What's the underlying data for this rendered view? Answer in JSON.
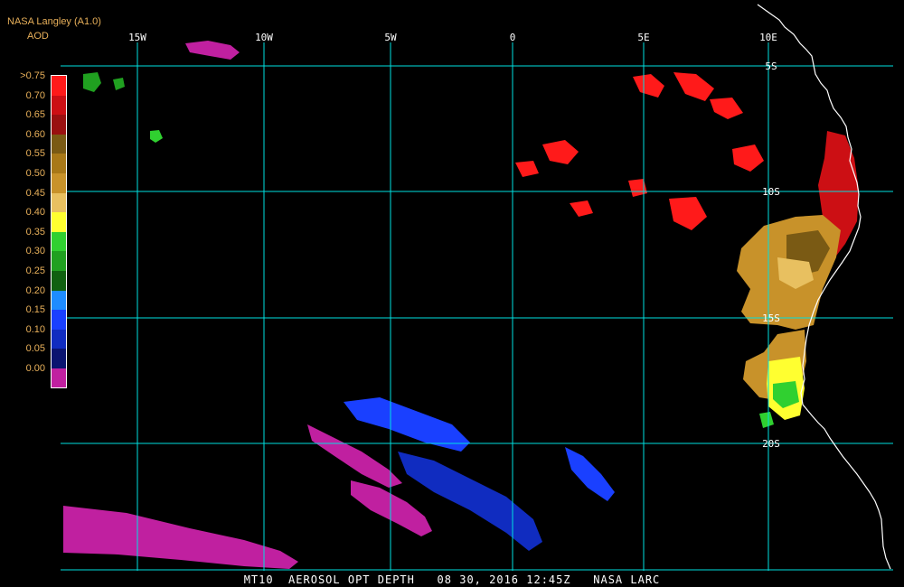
{
  "header": {
    "producer": "NASA Langley (A1.0)",
    "variable": "AOD"
  },
  "colorbar": {
    "labels": [
      ">0.75",
      "0.70",
      "0.65",
      "0.60",
      "0.55",
      "0.50",
      "0.45",
      "0.40",
      "0.35",
      "0.30",
      "0.25",
      "0.20",
      "0.15",
      "0.10",
      "0.05",
      "0.00"
    ],
    "colors": [
      "#ff1a1a",
      "#cc0f14",
      "#991010",
      "#7a5a14",
      "#a87818",
      "#c8922a",
      "#e8c060",
      "#ffff30",
      "#30d030",
      "#20a020",
      "#106010",
      "#1e8cff",
      "#1a40ff",
      "#102cc0",
      "#0a1470",
      "#c020a0"
    ]
  },
  "grid": {
    "lon_labels": [
      "15W",
      "10W",
      "5W",
      "0",
      "5E",
      "10E"
    ],
    "lat_labels": [
      "5S",
      "10S",
      "15S",
      "20S"
    ]
  },
  "footer": {
    "text": "MT10  AEROSOL OPT DEPTH   08 30, 2016 12:45Z   NASA LARC"
  },
  "colors": {
    "grid": "#00e0e0",
    "coast": "#ffffff",
    "text": "#e8b05a",
    "background": "#000000"
  }
}
